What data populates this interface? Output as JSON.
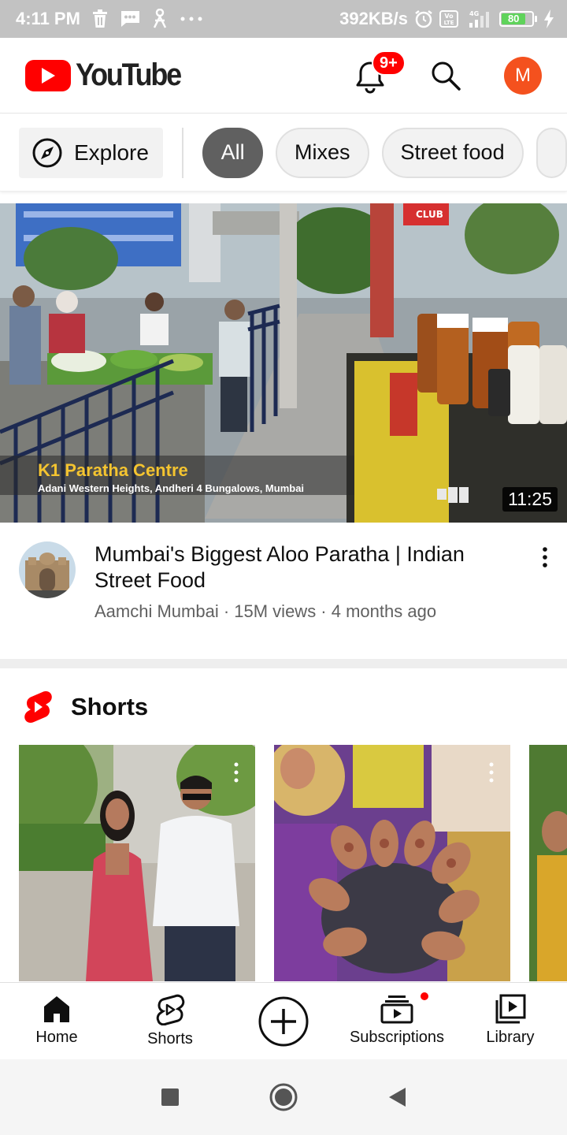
{
  "status_bar": {
    "time": "4:11 PM",
    "net_speed": "392KB/s",
    "net_type": "4G",
    "battery": "80"
  },
  "header": {
    "logo_text": "YouTube",
    "notification_badge": "9+",
    "avatar_letter": "M"
  },
  "chips": {
    "explore_label": "Explore",
    "items": [
      "All",
      "Mixes",
      "Street food"
    ]
  },
  "video": {
    "duration": "11:25",
    "overlay_title": "K1 Paratha Centre",
    "overlay_subtitle": "Adani Western Heights, Andheri 4 Bungalows, Mumbai",
    "title": "Mumbai's Biggest Aloo Paratha | Indian Street Food",
    "channel": "Aamchi Mumbai",
    "views": "15M views",
    "age": "4 months ago",
    "sub_line": "Aamchi Mumbai · 15M views · 4 months ago"
  },
  "shorts": {
    "title": "Shorts"
  },
  "bottom_nav": {
    "home": "Home",
    "shorts": "Shorts",
    "subscriptions": "Subscriptions",
    "library": "Library"
  },
  "colors": {
    "brand_red": "#ff0000",
    "avatar": "#f4511e",
    "active_chip": "#606060",
    "status_bar": "#c2c2c2"
  },
  "icons": {
    "notification": "bell-icon",
    "search": "search-icon",
    "explore": "compass-icon",
    "home": "home-icon",
    "shorts": "shorts-icon",
    "create": "add-circle-icon",
    "subscriptions": "subscriptions-icon",
    "library": "library-icon"
  }
}
